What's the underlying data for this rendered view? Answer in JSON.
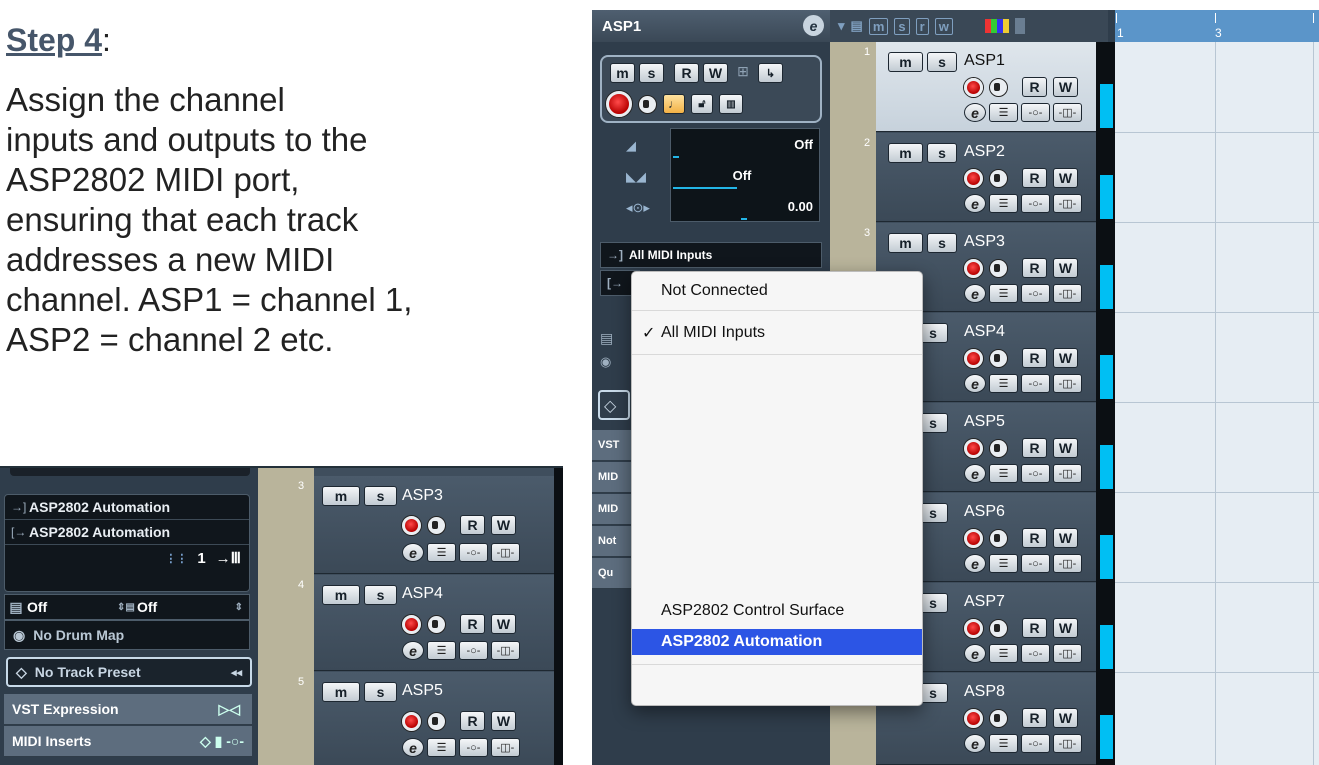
{
  "instructions": {
    "step_label": "Step 4",
    "step_suffix": ":",
    "body": "Assign the channel\ninputs and outputs to the\nASP2802 MIDI port,\nensuring that each track\naddresses a new MIDI\nchannel. ASP1 = channel 1,\nASP2 = channel 2 etc."
  },
  "zoom_panel": {
    "input_routing": "ASP2802 Automation",
    "output_routing": "ASP2802 Automation",
    "channel": "1",
    "bank_left": "Off",
    "bank_right": "Off",
    "drum_map": "No Drum Map",
    "track_preset": "No Track Preset",
    "sections": [
      "VST Expression",
      "MIDI Inserts"
    ],
    "tracks": [
      {
        "number": "3",
        "name": "ASP3"
      },
      {
        "number": "4",
        "name": "ASP4"
      },
      {
        "number": "5",
        "name": "ASP5"
      }
    ]
  },
  "window": {
    "track_title": "ASP1",
    "toolbar_buttons": [
      "m",
      "s",
      "r",
      "w"
    ],
    "ruler_marks": [
      "1",
      "3"
    ],
    "inspector": {
      "volume": "Off",
      "pan": "Off",
      "delay": "0.00",
      "input_routing": "All MIDI Inputs",
      "side_sections": [
        "VST",
        "MID",
        "MID",
        "Not",
        "Qu"
      ]
    },
    "tracks": [
      {
        "number": "1",
        "name": "ASP1"
      },
      {
        "number": "2",
        "name": "ASP2"
      },
      {
        "number": "3",
        "name": "ASP3"
      },
      {
        "number": "",
        "name": "ASP4"
      },
      {
        "number": "",
        "name": "ASP5"
      },
      {
        "number": "",
        "name": "ASP6"
      },
      {
        "number": "",
        "name": "ASP7"
      },
      {
        "number": "",
        "name": "ASP8"
      }
    ]
  },
  "buttons": {
    "mute": "m",
    "solo": "s",
    "read": "R",
    "write": "W",
    "edit": "e"
  },
  "dropdown": {
    "not_connected": "Not Connected",
    "all_midi_inputs": "All MIDI Inputs",
    "checkmark": "✓",
    "control_surface": "ASP2802 Control Surface",
    "automation": "ASP2802 Automation"
  },
  "colors": {
    "selection": "#2c55e5",
    "track_color": "#00bff3",
    "record": "#e00000"
  }
}
